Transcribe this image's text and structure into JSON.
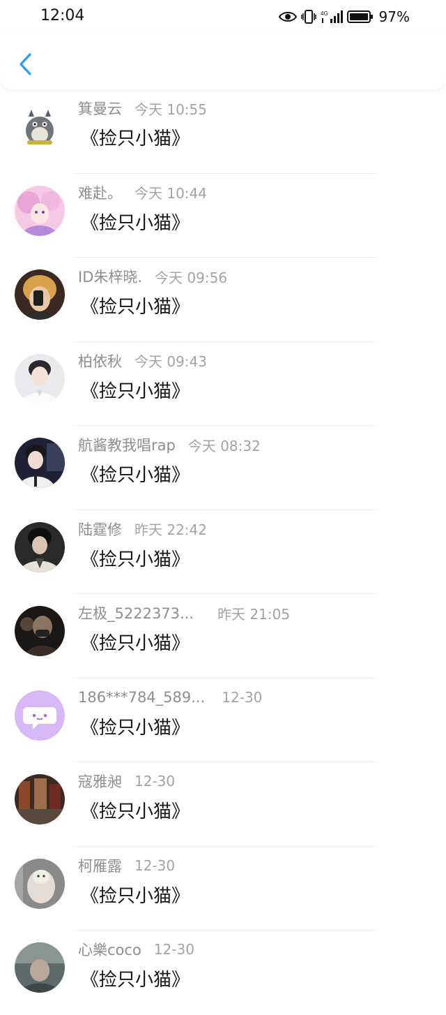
{
  "status_bar": {
    "time": "12:04",
    "network": "4G",
    "battery": "97%"
  },
  "header": {
    "back_icon": "chevron-left-icon",
    "accent_color": "#2d9bf0"
  },
  "messages": [
    {
      "name": "箕曼云",
      "time": "今天 10:55",
      "text": "《捡只小猫》"
    },
    {
      "name": "难赴。",
      "time": "今天 10:44",
      "text": "《捡只小猫》"
    },
    {
      "name": "ID朱梓晓.",
      "time": "今天 09:56",
      "text": "《捡只小猫》"
    },
    {
      "name": "柏依秋",
      "time": "今天 09:43",
      "text": "《捡只小猫》"
    },
    {
      "name": "航酱教我唱rap",
      "time": "今天 08:32",
      "text": "《捡只小猫》"
    },
    {
      "name": "陆霆修",
      "time": "昨天 22:42",
      "text": "《捡只小猫》"
    },
    {
      "name": "左极_5222373...",
      "time": "昨天 21:05",
      "text": "《捡只小猫》"
    },
    {
      "name": "186***784_589...",
      "time": "12-30",
      "text": "《捡只小猫》"
    },
    {
      "name": "寇雅昶",
      "time": "12-30",
      "text": "《捡只小猫》"
    },
    {
      "name": "柯雁露",
      "time": "12-30",
      "text": "《捡只小猫》"
    },
    {
      "name": "心樂coco",
      "time": "12-30",
      "text": "《捡只小猫》"
    }
  ]
}
